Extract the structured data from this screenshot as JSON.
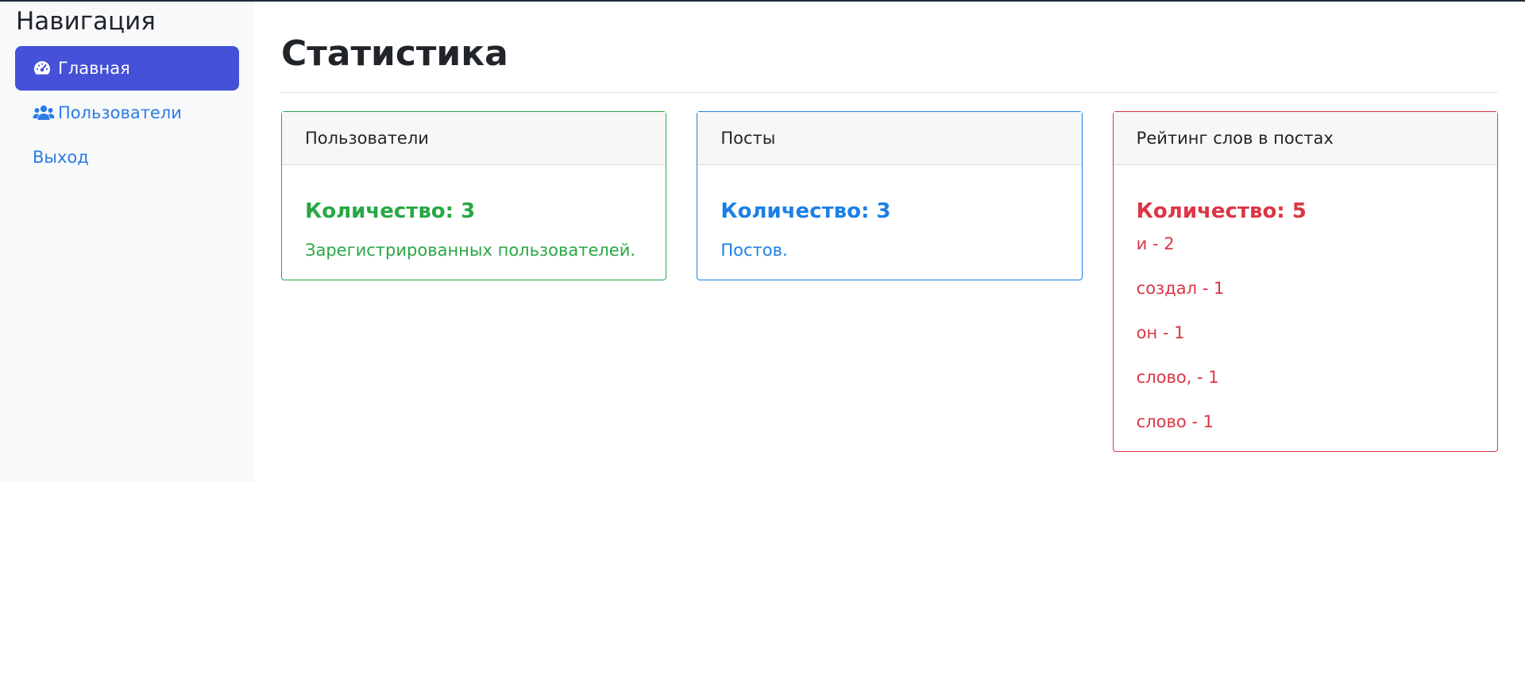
{
  "sidebar": {
    "title": "Навигация",
    "items": [
      {
        "label": "Главная",
        "icon": "dashboard-icon",
        "active": true
      },
      {
        "label": "Пользователи",
        "icon": "users-icon",
        "active": false
      },
      {
        "label": "Выход",
        "icon": "",
        "active": false
      }
    ]
  },
  "main": {
    "title": "Статистика",
    "cards": {
      "users": {
        "header": "Пользователи",
        "count": "Количество: 3",
        "text": "Зарегистрированных пользователей."
      },
      "posts": {
        "header": "Посты",
        "count": "Количество: 3",
        "text": "Постов."
      },
      "words": {
        "header": "Рейтинг слов в постах",
        "count": "Количество: 5",
        "items": [
          "и - 2",
          "создал - 1",
          "он - 1",
          "слово, - 1",
          "слово - 1"
        ]
      }
    }
  },
  "colors": {
    "active_nav": "#4451d8",
    "link": "#2b7be4",
    "success": "#28a745",
    "primary": "#1c7fe6",
    "danger": "#dc3545"
  }
}
